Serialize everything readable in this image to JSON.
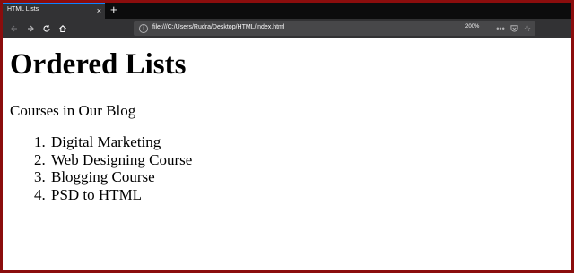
{
  "browser": {
    "tab_title": "HTML Lists",
    "tab_close": "×",
    "new_tab": "+",
    "url": "file:///C:/Users/Rudra/Desktop/HTML/index.html",
    "zoom": "200%",
    "icons": [
      "back-icon",
      "forward-icon",
      "reload-icon",
      "home-icon",
      "info-icon",
      "more-icon",
      "pocket-icon",
      "bookmark-star-icon"
    ]
  },
  "page": {
    "heading": "Ordered Lists",
    "paragraph": "Courses in Our Blog",
    "list_items": [
      "Digital Marketing",
      "Web Designing Course",
      "Blogging Course",
      "PSD to HTML"
    ]
  },
  "colors": {
    "frame_border": "#8b0d0d",
    "tab_accent": "#0a84ff",
    "chrome_dark": "#0c0c0d",
    "toolbar": "#323234"
  }
}
